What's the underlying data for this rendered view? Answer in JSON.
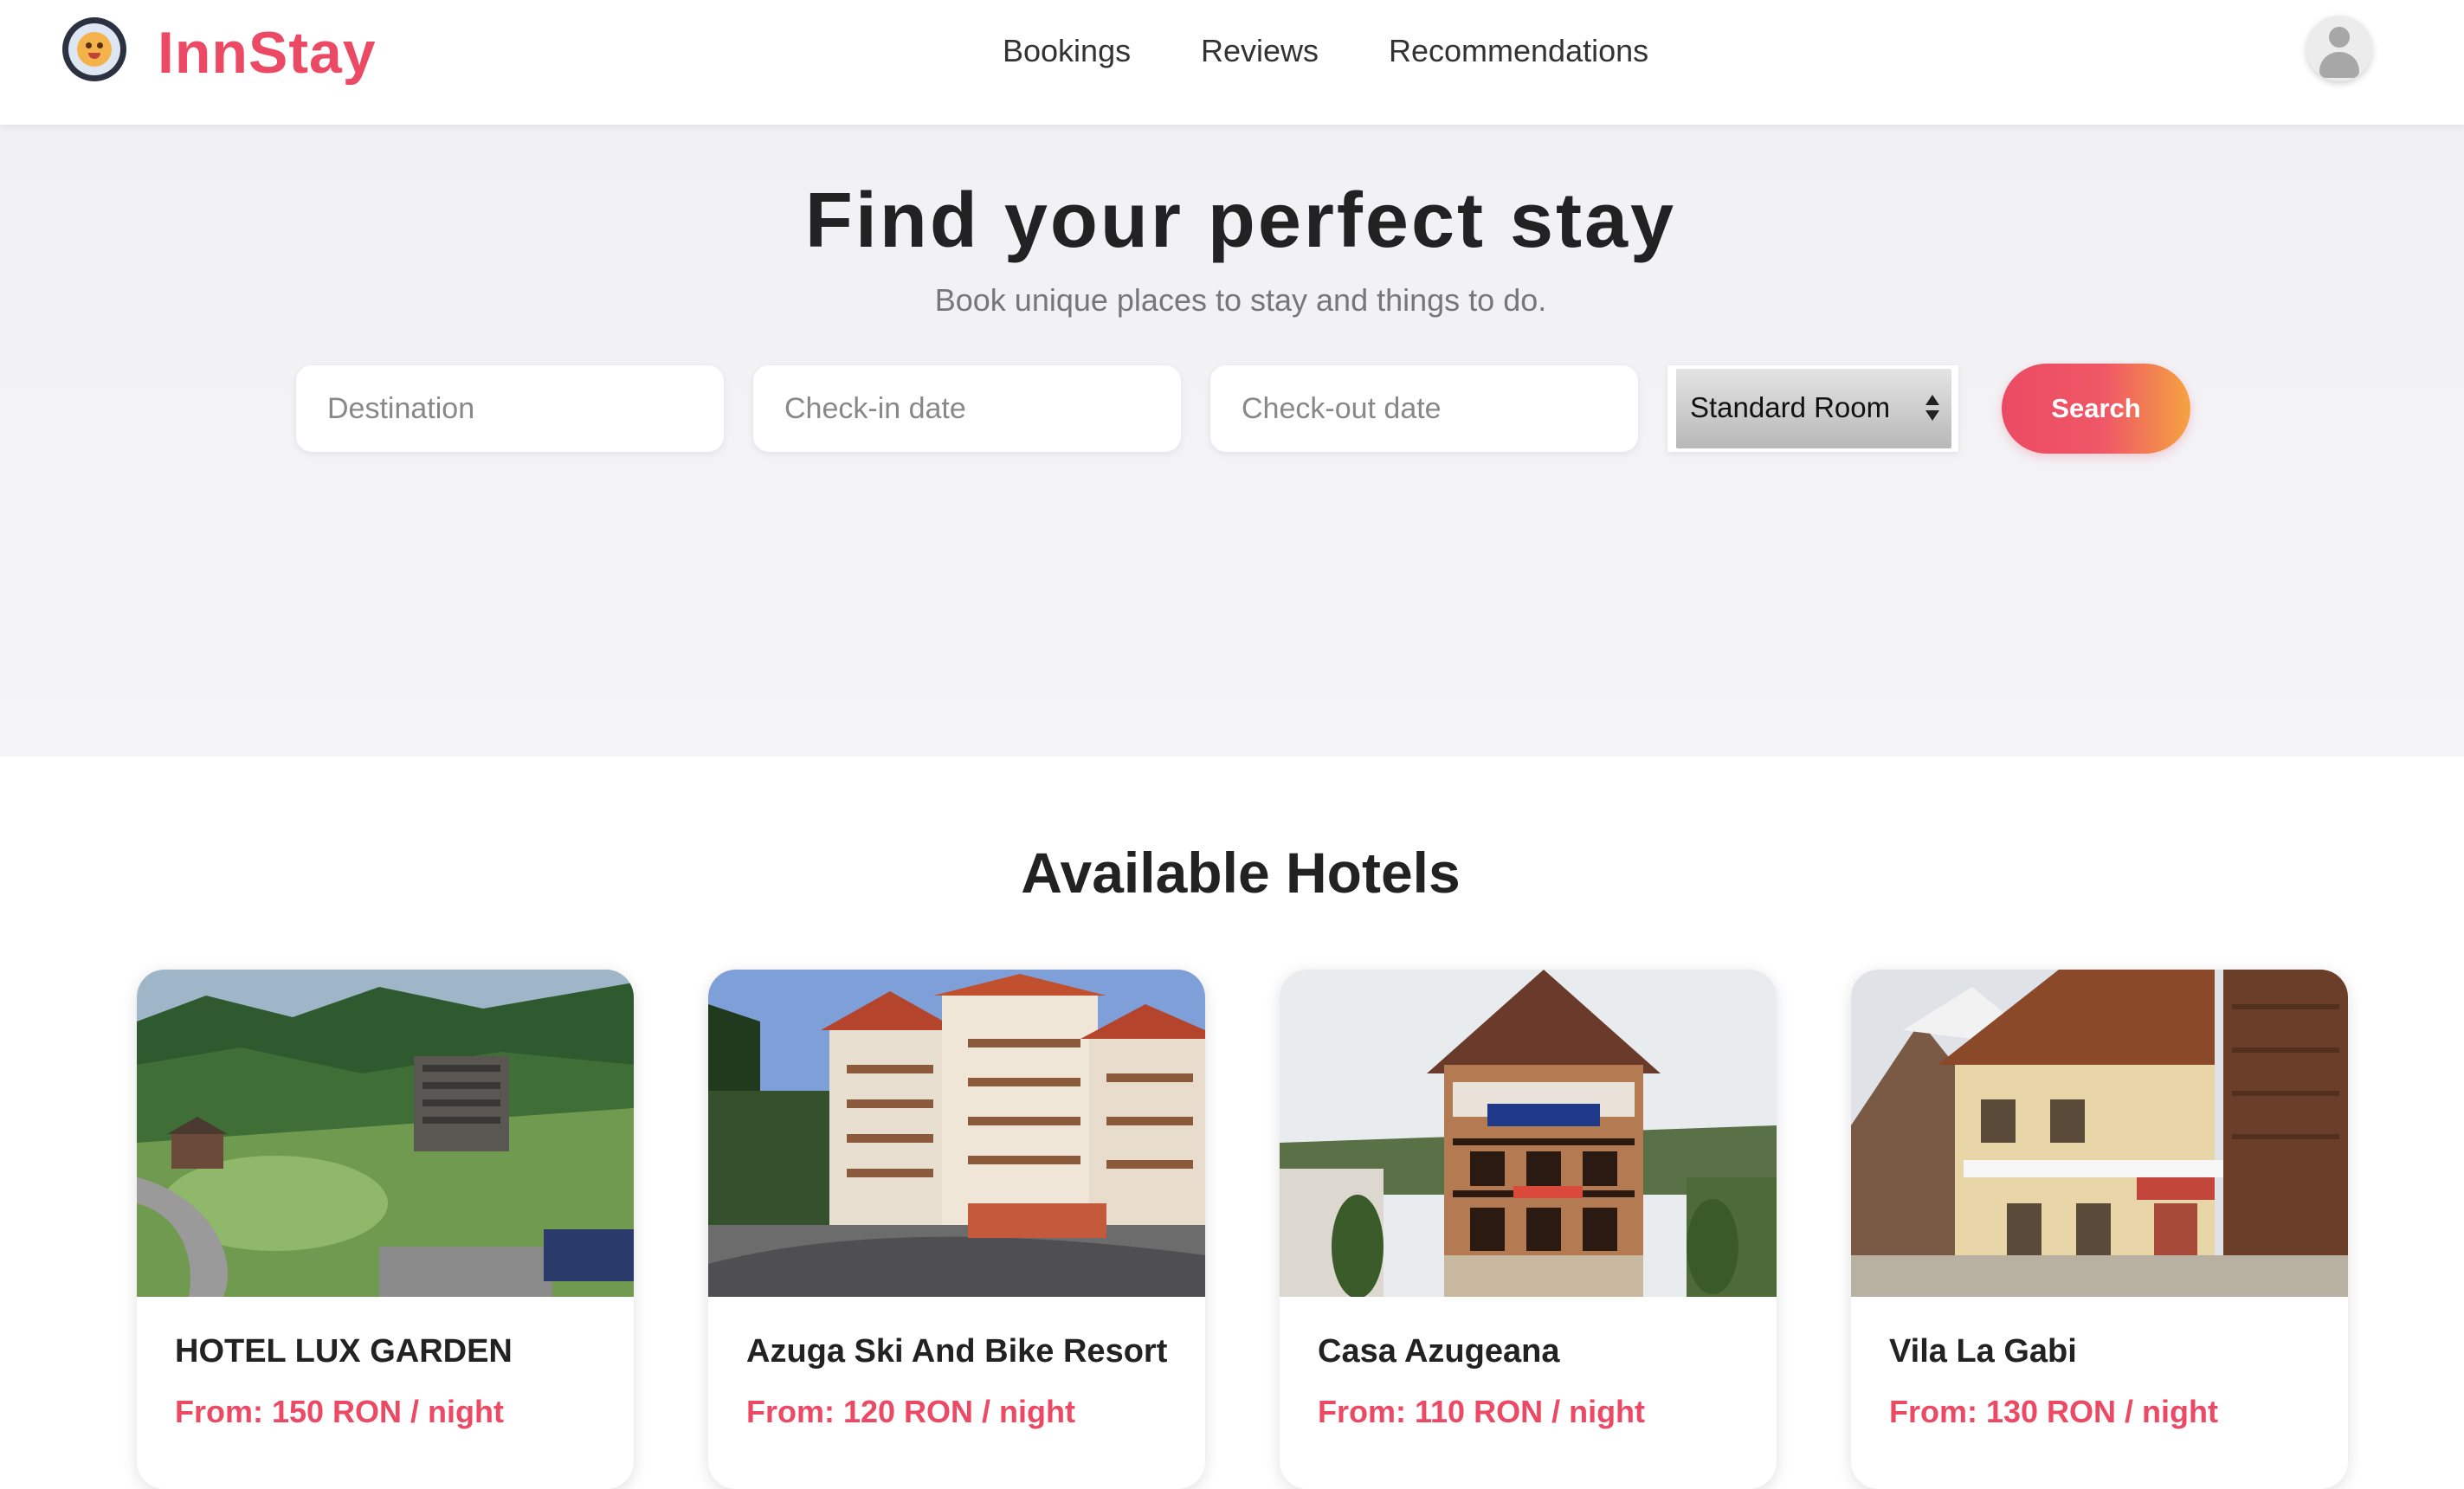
{
  "header": {
    "brand": "InnStay",
    "nav": [
      "Bookings",
      "Reviews",
      "Recommendations"
    ]
  },
  "hero": {
    "title": "Find your perfect stay",
    "subtitle": "Book unique places to stay and things to do.",
    "destination_placeholder": "Destination",
    "checkin_placeholder": "Check-in date",
    "checkout_placeholder": "Check-out date",
    "room_type_selected": "Standard Room",
    "search_label": "Search"
  },
  "hotels": {
    "title": "Available Hotels",
    "items": [
      {
        "name": "HOTEL LUX GARDEN",
        "price": "From: 150 RON / night"
      },
      {
        "name": "Azuga Ski And Bike Resort",
        "price": "From: 120 RON / night"
      },
      {
        "name": "Casa Azugeana",
        "price": "From: 110 RON / night"
      },
      {
        "name": "Vila La Gabi",
        "price": "From: 130 RON / night"
      }
    ]
  },
  "colors": {
    "brand": "#ec4a64",
    "button_gradient_end": "#f5a341"
  }
}
